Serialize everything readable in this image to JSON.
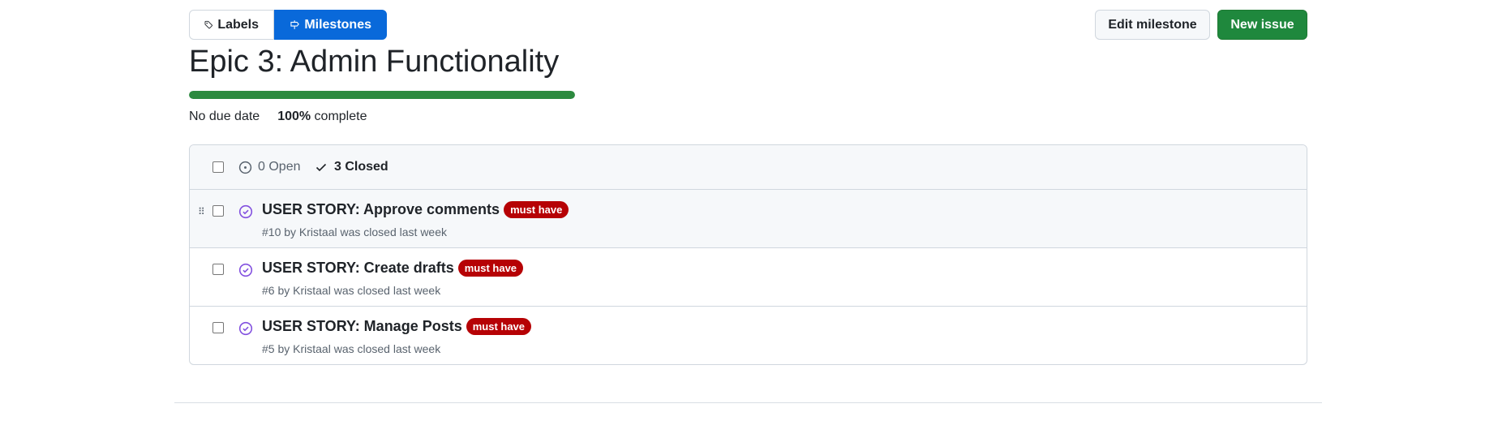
{
  "nav": {
    "labels": "Labels",
    "milestones": "Milestones"
  },
  "actions": {
    "edit": "Edit milestone",
    "new_issue": "New issue"
  },
  "milestone": {
    "title": "Epic 3: Admin Functionality",
    "due": "No due date",
    "percent": "100%",
    "percent_suffix": " complete",
    "progress": 1.0
  },
  "list": {
    "open": "0 Open",
    "closed": "3 Closed",
    "items": [
      {
        "title": "USER STORY: Approve comments",
        "label": "must have",
        "sub": "#10 by Kristaal was closed last week"
      },
      {
        "title": "USER STORY: Create drafts",
        "label": "must have",
        "sub": "#6 by Kristaal was closed last week"
      },
      {
        "title": "USER STORY: Manage Posts",
        "label": "must have",
        "sub": "#5 by Kristaal was closed last week"
      }
    ]
  },
  "colors": {
    "accent": "#0969da",
    "primary_green": "#1f883d",
    "progress": "#2c8a3f",
    "label_red": "#b60205",
    "closed_icon": "#8250df"
  },
  "icons": [
    "tag-icon",
    "milestone-icon",
    "issue-open-icon",
    "check-icon",
    "issue-closed-icon",
    "drag-handle-icon"
  ]
}
